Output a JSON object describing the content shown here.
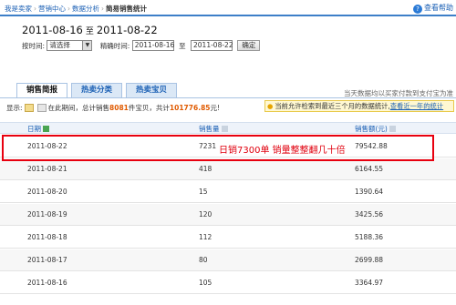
{
  "breadcrumb": [
    "我是卖家",
    "营销中心",
    "数据分析",
    "简易销售统计"
  ],
  "help": {
    "label": "查看帮助"
  },
  "range": {
    "start": "2011-08-16",
    "to": "至",
    "end": "2011-08-22"
  },
  "filters": {
    "period_label": "按时间:",
    "period_value": "请选择",
    "exact_label": "精确时间:",
    "start": "2011-08-16",
    "to": "至",
    "end": "2011-08-22",
    "confirm": "确定"
  },
  "tabs": [
    "销售简报",
    "热卖分类",
    "热卖宝贝"
  ],
  "note": "当天数据均以买家付款到支付宝为准",
  "display": {
    "label": "显示:",
    "summary_prefix": "在此期间，总计销售",
    "count": "8081",
    "summary_mid": "件宝贝，共计",
    "amount": "101776.85",
    "summary_suffix": "元!"
  },
  "tip": {
    "text": "当前允许检索到最近三个月的数据统计,",
    "link": "查看近一年的统计"
  },
  "table": {
    "headers": [
      "日期",
      "销售量",
      "销售额(元)"
    ],
    "rows": [
      {
        "date": "2011-08-22",
        "qty": "7231",
        "amount": "79542.88"
      },
      {
        "date": "2011-08-21",
        "qty": "418",
        "amount": "6164.55"
      },
      {
        "date": "2011-08-20",
        "qty": "15",
        "amount": "1390.64"
      },
      {
        "date": "2011-08-19",
        "qty": "120",
        "amount": "3425.56"
      },
      {
        "date": "2011-08-18",
        "qty": "112",
        "amount": "5188.36"
      },
      {
        "date": "2011-08-17",
        "qty": "80",
        "amount": "2699.88"
      },
      {
        "date": "2011-08-16",
        "qty": "105",
        "amount": "3364.97"
      }
    ]
  },
  "annotation": "日销7300单    销量整整翻几十倍",
  "colors": {
    "accent": "#1a5fb4",
    "highlight": "#e8000f"
  }
}
